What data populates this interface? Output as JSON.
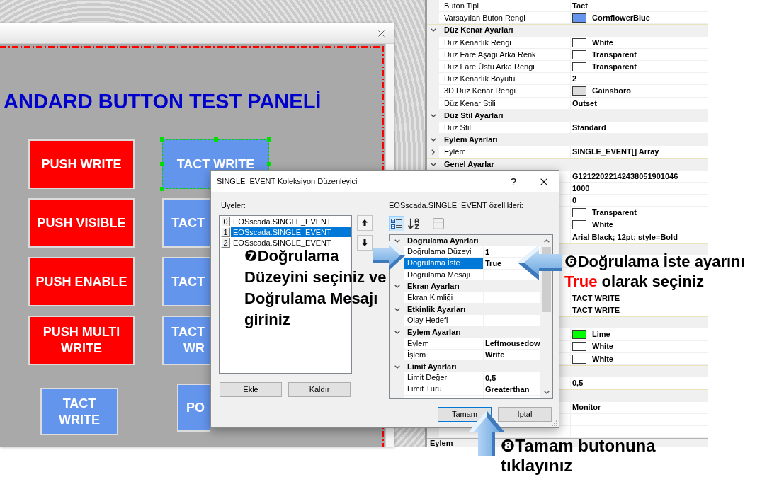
{
  "designer": {
    "title": "ANDARD BUTTON TEST PANELİ",
    "buttons": [
      {
        "label": "PUSH WRITE",
        "color": "#ff0000",
        "selected": false
      },
      {
        "label": "TACT WRITE",
        "color": "#6495ed",
        "selected": true
      },
      {
        "label": "PUSH VISIBLE",
        "color": "#ff0000",
        "selected": false
      },
      {
        "label": "TACT",
        "color": "#6495ed",
        "selected": false
      },
      {
        "label": "PUSH ENABLE",
        "color": "#ff0000",
        "selected": false
      },
      {
        "label": "TACT",
        "color": "#6495ed",
        "selected": false
      },
      {
        "label": "PUSH MULTI WRITE",
        "color": "#ff0000",
        "selected": false
      },
      {
        "label": "TACT WR",
        "color": "#6495ed",
        "selected": false
      },
      {
        "label": "TACT WRITE",
        "color": "#6495ed",
        "selected": false
      },
      {
        "label": "PO",
        "color": "#6495ed",
        "selected": false
      }
    ]
  },
  "properties": {
    "rows": [
      {
        "kind": "property",
        "name": "Buton Tipi",
        "value": "Tact"
      },
      {
        "kind": "property",
        "name": "Varsayılan Buton Rengi",
        "value": "CornflowerBlue",
        "color": "#6495ed"
      },
      {
        "kind": "category",
        "name": "Düz Kenar Ayarları",
        "expanded": true
      },
      {
        "kind": "property",
        "name": "Düz Kenarlık Rengi",
        "value": "White",
        "color": "#ffffff"
      },
      {
        "kind": "property",
        "name": "Düz Fare Aşağı Arka Renk",
        "value": "Transparent",
        "color": "#ffffff"
      },
      {
        "kind": "property",
        "name": "Düz Fare Üstü Arka Rengi",
        "value": "Transparent",
        "color": "#ffffff"
      },
      {
        "kind": "property",
        "name": "Düz Kenarlık Boyutu",
        "value": "2"
      },
      {
        "kind": "property",
        "name": "3D Düz Kenar Rengi",
        "value": "Gainsboro",
        "color": "#dcdcdc"
      },
      {
        "kind": "property",
        "name": "Düz Kenar Stili",
        "value": "Outset"
      },
      {
        "kind": "category",
        "name": "Düz Stil Ayarları",
        "expanded": true
      },
      {
        "kind": "property",
        "name": "Düz Stil",
        "value": "Standard"
      },
      {
        "kind": "category",
        "name": "Eylem Ayarları",
        "expanded": true
      },
      {
        "kind": "property",
        "name": "Eylem",
        "value": "SINGLE_EVENT[] Array",
        "expanded": false
      },
      {
        "kind": "category",
        "name": "Genel Ayarlar",
        "expanded": true
      },
      {
        "kind": "property",
        "value": "G12122022142438051901046"
      },
      {
        "kind": "property",
        "value": "1000"
      },
      {
        "kind": "property",
        "value": "0"
      },
      {
        "kind": "property",
        "value": "Transparent",
        "color": "#ffffff"
      },
      {
        "kind": "property",
        "value": "White",
        "color": "#ffffff"
      },
      {
        "kind": "property",
        "value": "Arial Black; 12pt; style=Bold"
      },
      {
        "kind": "category"
      },
      {
        "kind": "property"
      },
      {
        "kind": "property"
      },
      {
        "kind": "property"
      },
      {
        "kind": "property",
        "value": "TACT WRITE"
      },
      {
        "kind": "property",
        "value": "TACT WRITE"
      },
      {
        "kind": "category"
      },
      {
        "kind": "property",
        "value": "Lime",
        "color": "#00ff00"
      },
      {
        "kind": "property",
        "value": "White",
        "color": "#ffffff"
      },
      {
        "kind": "property",
        "value": "White",
        "color": "#ffffff"
      },
      {
        "kind": "category"
      },
      {
        "kind": "property",
        "value": "0,5"
      },
      {
        "kind": "category"
      },
      {
        "kind": "property",
        "value": "Monitor"
      }
    ],
    "description": "Eylem"
  },
  "dialog": {
    "title": "SINGLE_EVENT Koleksiyon Düzenleyici",
    "help_button": "?",
    "members_label": "Üyeler:",
    "members": [
      {
        "index": "0",
        "label": "EOSscada.SINGLE_EVENT",
        "selected": false
      },
      {
        "index": "1",
        "label": "EOSscada.SINGLE_EVENT",
        "selected": true
      },
      {
        "index": "2",
        "label": "EOSscada.SINGLE_EVENT",
        "selected": false
      }
    ],
    "add_button": "Ekle",
    "remove_button": "Kaldır",
    "properties_label": "EOSscada.SINGLE_EVENT özellikleri:",
    "toolbar": [
      {
        "kind": "categorized",
        "selected": true,
        "disabled": false
      },
      {
        "kind": "alphabetical",
        "selected": false,
        "disabled": false
      },
      {
        "kind": "property-pages",
        "selected": false,
        "disabled": true
      }
    ],
    "grid": [
      {
        "kind": "category",
        "name": "Doğrulama Ayarları",
        "expanded": true
      },
      {
        "kind": "property",
        "name": "Doğrulama Düzeyi",
        "value": "1",
        "selected": false
      },
      {
        "kind": "property",
        "name": "Doğrulama İste",
        "value": "True",
        "selected": true
      },
      {
        "kind": "property",
        "name": "Doğrulama Mesajı",
        "selected": false
      },
      {
        "kind": "category",
        "name": "Ekran Ayarları",
        "expanded": true
      },
      {
        "kind": "property",
        "name": "Ekran Kimliği",
        "selected": false
      },
      {
        "kind": "category",
        "name": "Etkinlik Ayarları",
        "expanded": true
      },
      {
        "kind": "property",
        "name": "Olay Hedefi",
        "selected": false
      },
      {
        "kind": "category",
        "name": "Eylem Ayarları",
        "expanded": true
      },
      {
        "kind": "property",
        "name": "Eylem",
        "value": "Leftmousedow",
        "selected": false
      },
      {
        "kind": "property",
        "name": "İşlem",
        "value": "Write",
        "selected": false
      },
      {
        "kind": "category",
        "name": "Limit Ayarları",
        "expanded": true
      },
      {
        "kind": "property",
        "name": "Limit Değeri",
        "value": "0,5",
        "selected": false
      },
      {
        "kind": "property",
        "name": "Limit Türü",
        "value": "Greaterthan",
        "selected": false
      }
    ],
    "ok_button": "Tamam",
    "cancel_button": "İptal"
  },
  "annotations": [
    {
      "lines": [
        [
          {
            "text": "❼Doğrulama",
            "highlight": false
          }
        ],
        [
          {
            "text": "Düzeyini seçiniz ve",
            "highlight": false
          }
        ],
        [
          {
            "text": "Doğrulama Mesajı",
            "highlight": false
          }
        ],
        [
          {
            "text": "giriniz",
            "highlight": false
          }
        ]
      ]
    },
    {
      "lines": [
        [
          {
            "text": "❻Doğrulama İste ayarını",
            "highlight": false
          }
        ],
        [
          {
            "text": "True",
            "highlight": true
          },
          {
            "text": "olarak seçiniz",
            "highlight": false
          }
        ]
      ]
    },
    {
      "lines": [
        [
          {
            "text": "❽Tamam butonuna",
            "highlight": false
          }
        ],
        [
          {
            "text": "tıklayınız",
            "highlight": false
          }
        ]
      ]
    }
  ]
}
